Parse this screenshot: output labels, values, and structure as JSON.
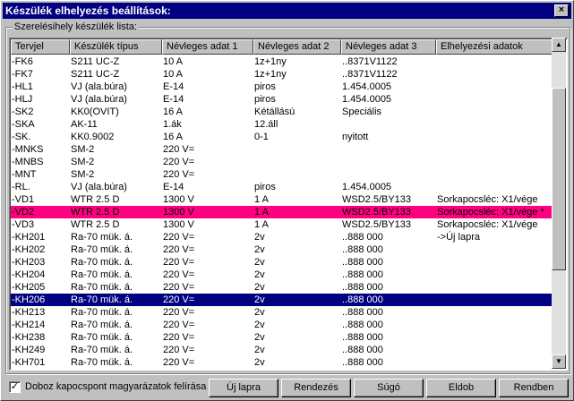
{
  "window": {
    "title": "Készülék elhelyezés beállítások:",
    "close": "×"
  },
  "group": {
    "label": "Szerelésihely készülék lista:"
  },
  "columns": [
    "Tervjel",
    "Készülék típus",
    "Névleges adat 1",
    "Névleges adat 2",
    "Névleges adat 3",
    "Elhelyezési adatok"
  ],
  "rows": [
    [
      "-FK6",
      "S211 UC-Z",
      "10 A",
      "1z+1ny",
      "..8371V1122",
      ""
    ],
    [
      "-FK7",
      "S211 UC-Z",
      "10 A",
      "1z+1ny",
      "..8371V1122",
      ""
    ],
    [
      "-HL1",
      "VJ (ala.búra)",
      "E-14",
      "piros",
      "1.454.0005",
      ""
    ],
    [
      "-HLJ",
      "VJ (ala.búra)",
      "E-14",
      "piros",
      "1.454.0005",
      ""
    ],
    [
      "-SK2",
      "KK0(OVIT)",
      "16 A",
      "Kétállású",
      "Speciális",
      ""
    ],
    [
      "-SKA",
      "AK-11",
      "1.ák",
      "12.áll",
      "",
      ""
    ],
    [
      "-SK.",
      "KK0.9002",
      "16 A",
      "0-1",
      "nyitott",
      ""
    ],
    [
      "-MNKS",
      "SM-2",
      "220 V=",
      "",
      "",
      ""
    ],
    [
      "-MNBS",
      "SM-2",
      "220 V=",
      "",
      "",
      ""
    ],
    [
      "-MNT",
      "SM-2",
      "220 V=",
      "",
      "",
      ""
    ],
    [
      "-RL.",
      "VJ (ala.búra)",
      "E-14",
      "piros",
      "1.454.0005",
      ""
    ],
    [
      "-VD1",
      "WTR 2.5 D",
      "1300 V",
      "1 A",
      "WSD2.5/BY133",
      "Sorkapocsléc: X1/vége"
    ],
    [
      "-VD2",
      "WTR 2.5 D",
      "1300 V",
      "1 A",
      "WSD2.5/BY133",
      "Sorkapocsléc: X1/vége *"
    ],
    [
      "-VD3",
      "WTR 2.5 D",
      "1300 V",
      "1 A",
      "WSD2.5/BY133",
      "Sorkapocsléc: X1/vége"
    ],
    [
      "-KH201",
      "Ra-70 mük. á.",
      "220 V=",
      "2v",
      "..888 000",
      " ->Új lapra"
    ],
    [
      "-KH202",
      "Ra-70 mük. á.",
      "220 V=",
      "2v",
      "..888 000",
      ""
    ],
    [
      "-KH203",
      "Ra-70 mük. á.",
      "220 V=",
      "2v",
      "..888 000",
      ""
    ],
    [
      "-KH204",
      "Ra-70 mük. á.",
      "220 V=",
      "2v",
      "..888 000",
      ""
    ],
    [
      "-KH205",
      "Ra-70 mük. á.",
      "220 V=",
      "2v",
      "..888 000",
      ""
    ],
    [
      "-KH206",
      "Ra-70 mük. á.",
      "220 V=",
      "2v",
      "..888 000",
      ""
    ],
    [
      "-KH213",
      "Ra-70 mük. á.",
      "220 V=",
      "2v",
      "..888 000",
      ""
    ],
    [
      "-KH214",
      "Ra-70 mük. á.",
      "220 V=",
      "2v",
      "..888 000",
      ""
    ],
    [
      "-KH238",
      "Ra-70 mük. á.",
      "220 V=",
      "2v",
      "..888 000",
      ""
    ],
    [
      "-KH249",
      "Ra-70 mük. á.",
      "220 V=",
      "2v",
      "..888 000",
      ""
    ],
    [
      "-KH701",
      "Ra-70 mük. á.",
      "220 V=",
      "2v",
      "..888 000",
      ""
    ]
  ],
  "highlight_row": 12,
  "selected_row": 19,
  "checkbox": {
    "checked": true,
    "mark": "✓",
    "label": "Doboz kapocspont magyarázatok felírása"
  },
  "buttons": {
    "new_page": "Új lapra",
    "arrange": "Rendezés",
    "help": "Súgó",
    "back": "Eldob",
    "ok": "Rendben"
  },
  "scrollbar": {
    "up": "▲",
    "down": "▼"
  }
}
